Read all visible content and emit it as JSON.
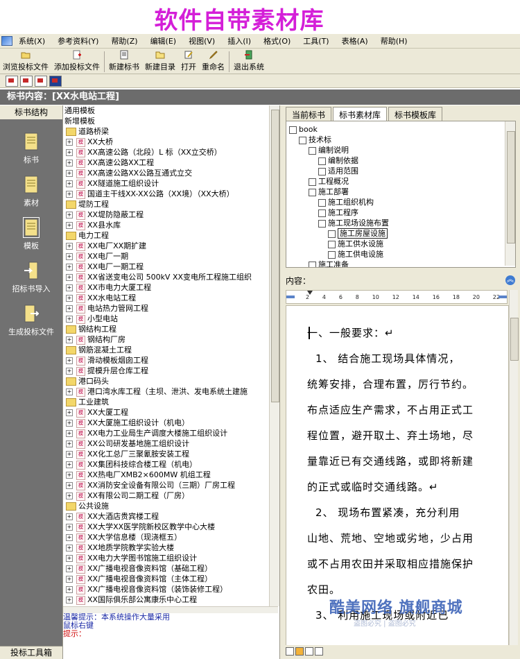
{
  "banner_title": "软件自带素材库",
  "menu": [
    "系统(X)",
    "参考资料(Y)",
    "帮助(Z)",
    "编辑(E)",
    "视图(V)",
    "插入(I)",
    "格式(O)",
    "工具(T)",
    "表格(A)",
    "帮助(H)"
  ],
  "toolbar": [
    "浏览投标文件",
    "添加投标文件",
    "新建标书",
    "新建目录",
    "打开",
    "重命名",
    "退出系统"
  ],
  "doc_title": "标书内容：[XX水电站工程]",
  "left_panel": {
    "header": "标书结构",
    "items": [
      "标书",
      "素材",
      "模板",
      "招标书导入",
      "生成投标文件"
    ],
    "footer": "投标工具箱"
  },
  "tree": [
    {
      "t": "通用模板",
      "lvl": 0,
      "kind": "text"
    },
    {
      "t": "新增模板",
      "lvl": 0,
      "kind": "text"
    },
    {
      "t": "道路桥梁",
      "lvl": 1,
      "kind": "folder"
    },
    {
      "t": "XX大桥",
      "lvl": 2,
      "kind": "doc"
    },
    {
      "t": "XX高速公路（北段）L 标（XX立交桥）",
      "lvl": 2,
      "kind": "doc"
    },
    {
      "t": "XX高速公路XX工程",
      "lvl": 2,
      "kind": "doc"
    },
    {
      "t": "XX高速公路XX公路互通式立交",
      "lvl": 2,
      "kind": "doc"
    },
    {
      "t": "XX隧道施工组织设计",
      "lvl": 2,
      "kind": "doc"
    },
    {
      "t": "国道主干线XX-XX公路（XX境）（XX大桥）",
      "lvl": 2,
      "kind": "doc"
    },
    {
      "t": "堤防工程",
      "lvl": 1,
      "kind": "folder"
    },
    {
      "t": "XX堤防隐蔽工程",
      "lvl": 2,
      "kind": "doc"
    },
    {
      "t": "XX县水库",
      "lvl": 2,
      "kind": "doc"
    },
    {
      "t": "电力工程",
      "lvl": 1,
      "kind": "folder"
    },
    {
      "t": "XX电厂XX期扩建",
      "lvl": 2,
      "kind": "doc"
    },
    {
      "t": "XX电厂一期",
      "lvl": 2,
      "kind": "doc"
    },
    {
      "t": "XX电厂一期工程",
      "lvl": 2,
      "kind": "doc"
    },
    {
      "t": "XX省送变电公司 500kV XX变电所工程施工组织",
      "lvl": 2,
      "kind": "doc"
    },
    {
      "t": "XX市电力大厦工程",
      "lvl": 2,
      "kind": "doc"
    },
    {
      "t": "XX水电站工程",
      "lvl": 2,
      "kind": "doc"
    },
    {
      "t": "电站热力管网工程",
      "lvl": 2,
      "kind": "doc"
    },
    {
      "t": "小型电站",
      "lvl": 2,
      "kind": "doc"
    },
    {
      "t": "钢结构工程",
      "lvl": 1,
      "kind": "folder"
    },
    {
      "t": "钢结构厂房",
      "lvl": 2,
      "kind": "doc"
    },
    {
      "t": "钢筋混凝土工程",
      "lvl": 1,
      "kind": "folder"
    },
    {
      "t": "滑动模板烟囱工程",
      "lvl": 2,
      "kind": "doc"
    },
    {
      "t": "提模升层仓库工程",
      "lvl": 2,
      "kind": "doc"
    },
    {
      "t": "港口码头",
      "lvl": 1,
      "kind": "folder"
    },
    {
      "t": "港口湾水库工程（主坝、泄洪、发电系统土建施",
      "lvl": 2,
      "kind": "doc"
    },
    {
      "t": "工业建筑",
      "lvl": 1,
      "kind": "folder"
    },
    {
      "t": "XX大厦工程",
      "lvl": 2,
      "kind": "doc"
    },
    {
      "t": "XX大厦施工组织设计（机电）",
      "lvl": 2,
      "kind": "doc"
    },
    {
      "t": "XX电力工业局生产调度大楼施工组织设计",
      "lvl": 2,
      "kind": "doc"
    },
    {
      "t": "XX公司研发基地施工组织设计",
      "lvl": 2,
      "kind": "doc"
    },
    {
      "t": "XX化工总厂三聚氰胺安装工程",
      "lvl": 2,
      "kind": "doc"
    },
    {
      "t": "XX集团科技综合楼工程（机电）",
      "lvl": 2,
      "kind": "doc"
    },
    {
      "t": "XX热电厂XMB2×600MW 机组工程",
      "lvl": 2,
      "kind": "doc"
    },
    {
      "t": "XX消防安全设备有限公司（三期）厂房工程",
      "lvl": 2,
      "kind": "doc"
    },
    {
      "t": "XX有限公司二期工程（厂房）",
      "lvl": 2,
      "kind": "doc"
    },
    {
      "t": "公共设施",
      "lvl": 1,
      "kind": "folder"
    },
    {
      "t": "XX大酒店贵宾楼工程",
      "lvl": 2,
      "kind": "doc"
    },
    {
      "t": "XX大学XX医学院新校区教学中心大楼",
      "lvl": 2,
      "kind": "doc"
    },
    {
      "t": "XX大学信息楼（现浇框五）",
      "lvl": 2,
      "kind": "doc"
    },
    {
      "t": "XX地质学院教学实验大楼",
      "lvl": 2,
      "kind": "doc"
    },
    {
      "t": "XX电力大学图书馆施工组织设计",
      "lvl": 2,
      "kind": "doc"
    },
    {
      "t": "XX广播电视音像资料馆（基础工程）",
      "lvl": 2,
      "kind": "doc"
    },
    {
      "t": "XX广播电视音像资料馆（主体工程）",
      "lvl": 2,
      "kind": "doc"
    },
    {
      "t": "XX广播电视音像资料馆（装饰装修工程）",
      "lvl": 2,
      "kind": "doc"
    },
    {
      "t": "XX国际俱乐部公寓康乐中心工程",
      "lvl": 2,
      "kind": "doc"
    }
  ],
  "hint": {
    "line1": "温馨提示：本系统操作大量采用",
    "line2": "鼠标右键",
    "line3": "提示："
  },
  "right_tabs": [
    "当前标书",
    "标书素材库",
    "标书模板库"
  ],
  "right_tree": [
    {
      "t": "book",
      "lvl": 0
    },
    {
      "t": "技术标",
      "lvl": 1
    },
    {
      "t": "编制说明",
      "lvl": 2
    },
    {
      "t": "编制依据",
      "lvl": 3
    },
    {
      "t": "适用范围",
      "lvl": 3
    },
    {
      "t": "工程概况",
      "lvl": 2
    },
    {
      "t": "施工部署",
      "lvl": 2
    },
    {
      "t": "施工组织机构",
      "lvl": 3
    },
    {
      "t": "施工程序",
      "lvl": 3
    },
    {
      "t": "施工现场设施布置",
      "lvl": 3
    },
    {
      "t": "施工房屋设施",
      "lvl": 4,
      "sel": true
    },
    {
      "t": "施工供水设施",
      "lvl": 4
    },
    {
      "t": "施工供电设施",
      "lvl": 4
    },
    {
      "t": "施工准备",
      "lvl": 2
    }
  ],
  "content_label": "内容：",
  "ruler_marks": [
    "2",
    "4",
    "6",
    "8",
    "10",
    "12",
    "14",
    "16",
    "18",
    "20",
    "22"
  ],
  "editor_lines": [
    "一、一般要求：↵",
    "1、   结合施工现场具体情况，",
    "统筹安排，合理布置，厉行节约。",
    "布点适应生产需求，不占用正式工",
    "程位置，避开取土、弃土场地，尽",
    "量靠近已有交通线路，或即将新建",
    "的正式或临时交通线路。↵",
    "2、   现场布置紧凑，充分利用",
    "山地、荒地、空地或劣地，少占用",
    "或不占用农田并采取相应措施保护",
    "农田。",
    "3、   利用施工现场或附近已"
  ],
  "watermark": "酷美网络 旗舰商城",
  "watermark_sub": "盗图必究 | 盗图必究"
}
